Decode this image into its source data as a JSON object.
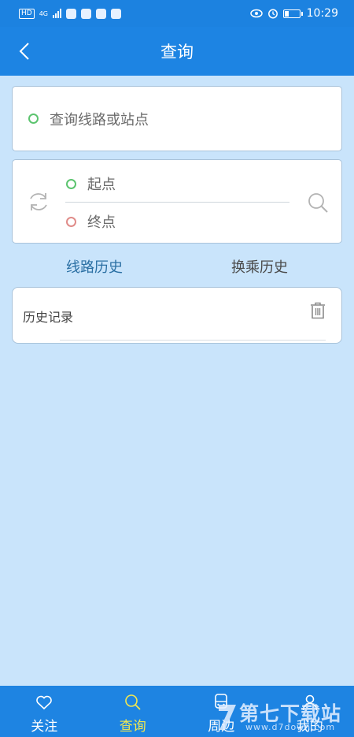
{
  "status_bar": {
    "network_badge": "HD",
    "network_type": "4G",
    "time": "10:29"
  },
  "header": {
    "title": "查询"
  },
  "search": {
    "placeholder": "查询线路或站点"
  },
  "route": {
    "start_label": "起点",
    "end_label": "终点"
  },
  "tabs": [
    {
      "label": "线路历史",
      "active": true
    },
    {
      "label": "换乘历史",
      "active": false
    }
  ],
  "history": {
    "title": "历史记录"
  },
  "bottom_nav": [
    {
      "label": "关注",
      "icon": "heart-icon",
      "active": false
    },
    {
      "label": "查询",
      "icon": "search-icon",
      "active": true
    },
    {
      "label": "周边",
      "icon": "bus-icon",
      "active": false
    },
    {
      "label": "我的",
      "icon": "user-icon",
      "active": false
    }
  ],
  "watermark": {
    "brand": "第七下载站",
    "url": "www.d7down.com"
  },
  "colors": {
    "primary": "#1d84e3",
    "background": "#c9e4fb",
    "start_dot": "#5cc46f",
    "end_dot": "#e08c89",
    "active_tab": "#2a6fa3",
    "active_nav": "#f4e84f"
  }
}
